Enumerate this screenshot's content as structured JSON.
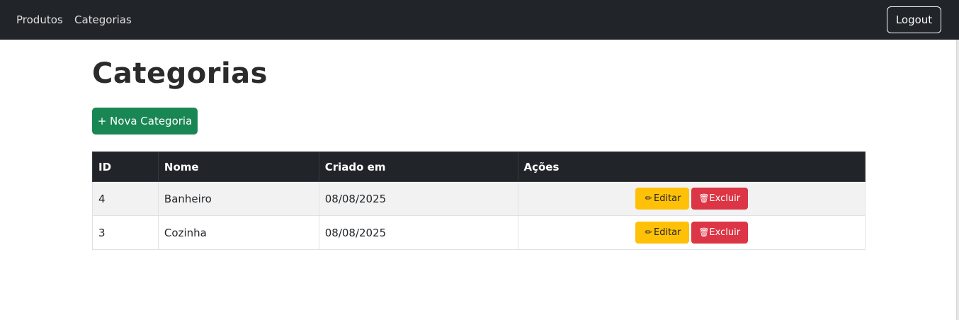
{
  "navbar": {
    "links": [
      {
        "label": "Produtos"
      },
      {
        "label": "Categorias"
      }
    ],
    "logout_label": "Logout"
  },
  "page": {
    "title": "Categorias",
    "new_button_label": "+ Nova Categoria"
  },
  "table": {
    "headers": [
      "ID",
      "Nome",
      "Criado em",
      "Ações"
    ],
    "rows": [
      {
        "id": "4",
        "nome": "Banheiro",
        "criado_em": "08/08/2025"
      },
      {
        "id": "3",
        "nome": "Cozinha",
        "criado_em": "08/08/2025"
      }
    ],
    "actions": {
      "edit_label": "Editar",
      "edit_icon": "pencil-icon",
      "delete_label": "Excluir",
      "delete_icon": "trash-icon"
    }
  },
  "colors": {
    "navbar": "#212529",
    "success": "#198754",
    "warning": "#ffc107",
    "danger": "#dc3545"
  }
}
